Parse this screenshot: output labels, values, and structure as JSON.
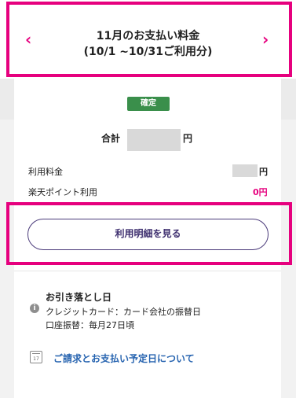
{
  "header": {
    "title_line1": "11月のお支払い料金",
    "title_line2": "(10/1 ~10/31ご利用分)",
    "prev_icon": "chevron-left-icon",
    "next_icon": "chevron-right-icon"
  },
  "status_badge": "確定",
  "total": {
    "label": "合計",
    "currency": "円"
  },
  "lines": [
    {
      "label": "利用料金",
      "value": "円"
    },
    {
      "label": "楽天ポイント利用",
      "value": "0円"
    }
  ],
  "details_button": "利用明細を見る",
  "debit": {
    "title": "お引き落とし日",
    "credit_card": "クレジットカード：カード会社の振替日",
    "bank_transfer": "口座振替：毎月27日頃"
  },
  "schedule_link": "ご請求とお支払い予定日について",
  "colors": {
    "accent": "#e6007e",
    "badge": "#3a8f4b",
    "link": "#2764b0",
    "button_text": "#3d2e6e"
  }
}
